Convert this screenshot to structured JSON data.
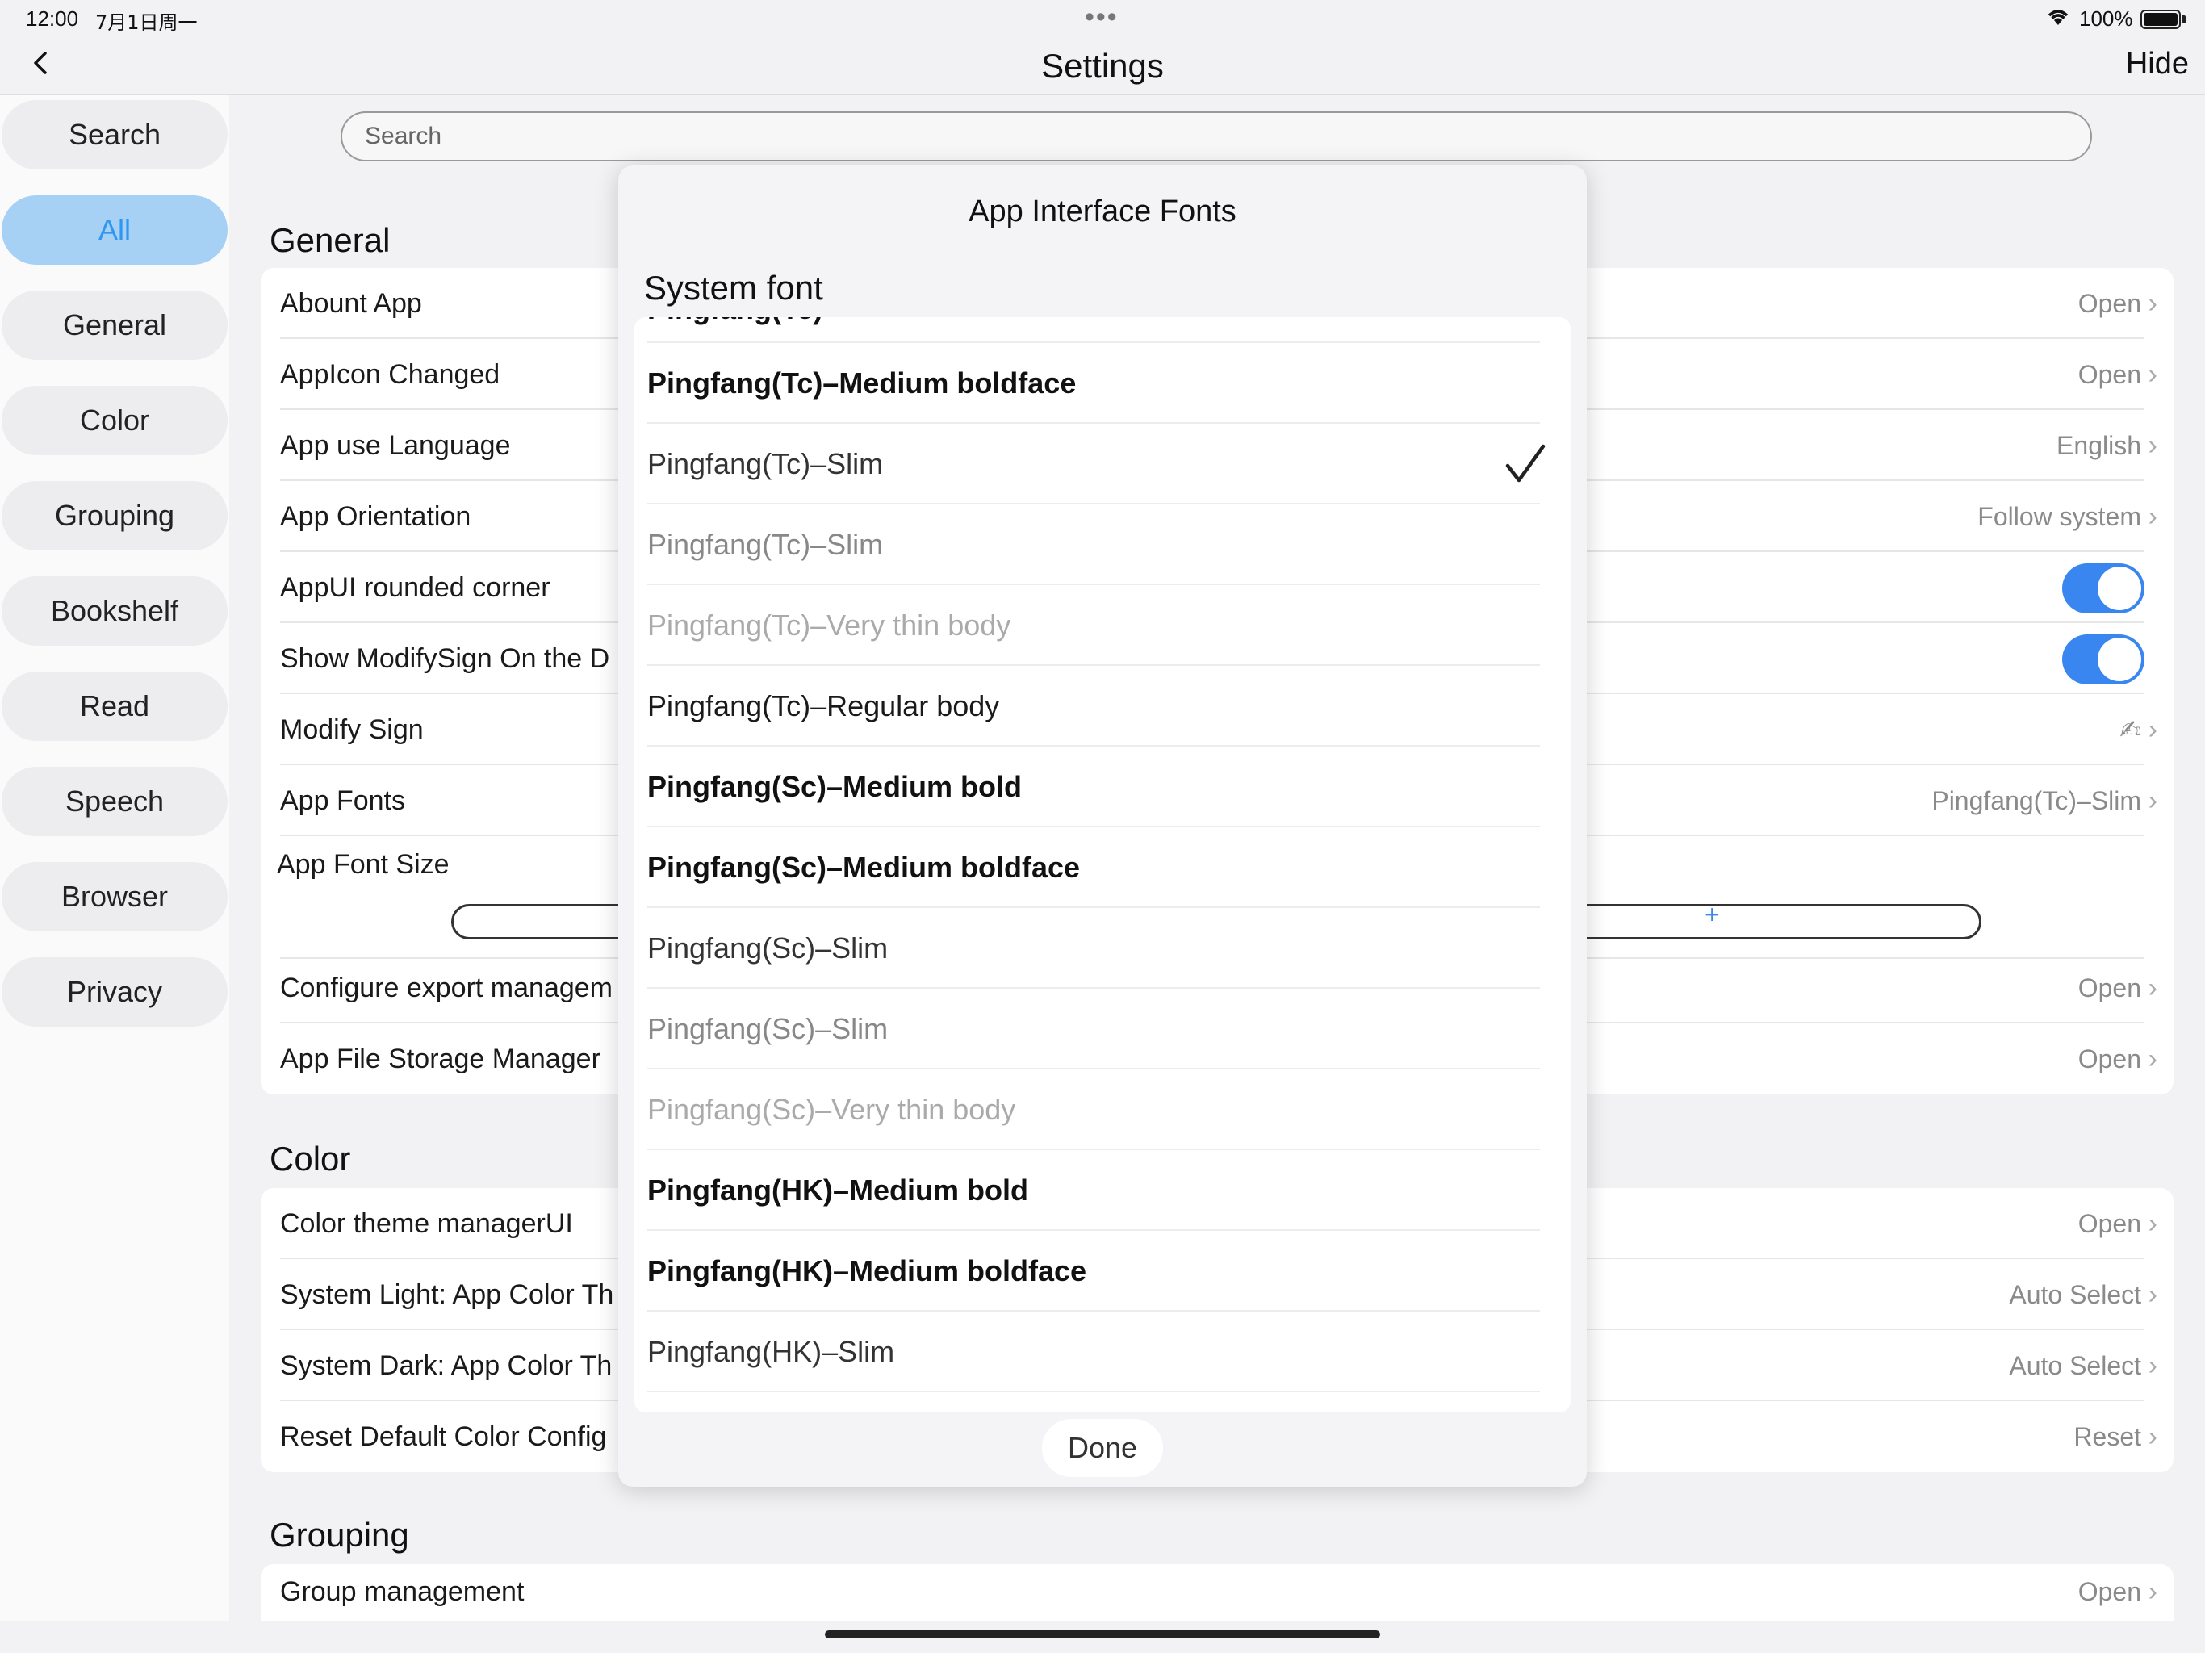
{
  "status": {
    "time": "12:00",
    "date": "7月1日周一",
    "battery": "100%"
  },
  "nav": {
    "title": "Settings",
    "hide": "Hide"
  },
  "sidebar": {
    "items": [
      "Search",
      "All",
      "General",
      "Color",
      "Grouping",
      "Bookshelf",
      "Read",
      "Speech",
      "Browser",
      "Privacy"
    ],
    "active": "All"
  },
  "search": {
    "placeholder": "Search"
  },
  "general": {
    "title": "General",
    "rows": [
      {
        "label": "Abount App",
        "value": "Open"
      },
      {
        "label": "AppIcon Changed",
        "value": "Open"
      },
      {
        "label": "App use Language",
        "value": "English"
      },
      {
        "label": "App Orientation",
        "value": "Follow system"
      },
      {
        "label": "AppUI rounded corner",
        "toggle": true
      },
      {
        "label": "Show ModifySign On the D",
        "toggle": true
      },
      {
        "label": "Modify Sign",
        "value": "✍"
      },
      {
        "label": "App Fonts",
        "value": "Pingfang(Tc)–Slim"
      },
      {
        "label": "App Font Size",
        "stepper_plus": "+"
      },
      {
        "label": "Configure export managem",
        "value": "Open"
      },
      {
        "label": "App File Storage Manager",
        "value": "Open"
      }
    ]
  },
  "color": {
    "title": "Color",
    "rows": [
      {
        "label": "Color theme managerUI",
        "value": "Open"
      },
      {
        "label": "System Light: App Color Th",
        "value": "Auto Select"
      },
      {
        "label": "System Dark: App Color Th",
        "value": "Auto Select"
      },
      {
        "label": "Reset Default Color Config",
        "value": "Reset"
      }
    ]
  },
  "grouping": {
    "title": "Grouping",
    "rows": [
      {
        "label": "Group management",
        "value": "Open"
      }
    ]
  },
  "modal": {
    "title": "App Interface Fonts",
    "subtitle": "System font",
    "selected": "Pingfang(Tc)–Slim",
    "done": "Done",
    "fonts": [
      {
        "name": "Pingfang(Tc)–Medium boldface",
        "weight": "bold"
      },
      {
        "name": "Pingfang(Tc)–Slim",
        "weight": "slim",
        "checked": true
      },
      {
        "name": "Pingfang(Tc)–Slim",
        "weight": "light"
      },
      {
        "name": "Pingfang(Tc)–Very thin body",
        "weight": "thin"
      },
      {
        "name": "Pingfang(Tc)–Regular body",
        "weight": "regular"
      },
      {
        "name": "Pingfang(Sc)–Medium bold",
        "weight": "bold"
      },
      {
        "name": "Pingfang(Sc)–Medium boldface",
        "weight": "bold"
      },
      {
        "name": "Pingfang(Sc)–Slim",
        "weight": "slim"
      },
      {
        "name": "Pingfang(Sc)–Slim",
        "weight": "light"
      },
      {
        "name": "Pingfang(Sc)–Very thin body",
        "weight": "thin"
      },
      {
        "name": "Pingfang(HK)–Medium bold",
        "weight": "bold"
      },
      {
        "name": "Pingfang(HK)–Medium boldface",
        "weight": "bold"
      },
      {
        "name": "Pingfang(HK)–Slim",
        "weight": "slim"
      }
    ]
  },
  "colors": {
    "accent": "#3a86f0",
    "active_tab_bg": "#a6d0f4"
  }
}
